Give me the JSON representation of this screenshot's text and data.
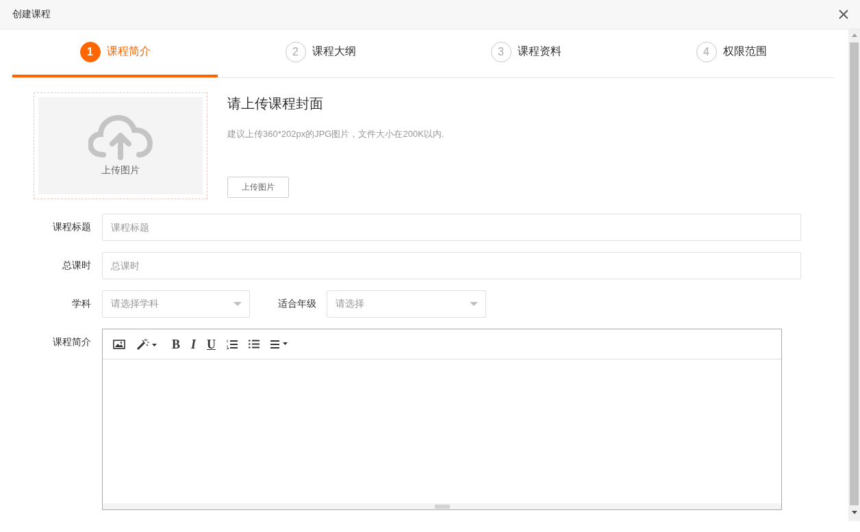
{
  "window": {
    "title": "创建课程"
  },
  "steps": [
    {
      "number": "1",
      "label": "课程简介",
      "selected": true
    },
    {
      "number": "2",
      "label": "课程大纲",
      "selected": false
    },
    {
      "number": "3",
      "label": "课程资料",
      "selected": false
    },
    {
      "number": "4",
      "label": "权限范围",
      "selected": false
    }
  ],
  "cover": {
    "heading": "请上传课程封面",
    "hint": "建议上传360*202px的JPG图片，文件大小在200K以内.",
    "dropzone_label": "上传图片",
    "button": "上传图片"
  },
  "fields": [
    {
      "label": "课程标题",
      "placeholder": "课程标题"
    },
    {
      "label": "总课时",
      "placeholder": "总课时"
    }
  ],
  "selects": [
    {
      "label": "学科",
      "placeholder": "请选择学科"
    },
    {
      "label": "适合年级",
      "placeholder": "请选择"
    }
  ],
  "editor": {
    "label": "课程简介",
    "toolbar": [
      {
        "kind": "image"
      },
      {
        "kind": "magic"
      },
      {
        "kind": "bold",
        "text": "B"
      },
      {
        "kind": "italic",
        "text": "I"
      },
      {
        "kind": "underline",
        "text": "U"
      },
      {
        "kind": "ordered"
      },
      {
        "kind": "bullet"
      },
      {
        "kind": "align"
      }
    ]
  }
}
